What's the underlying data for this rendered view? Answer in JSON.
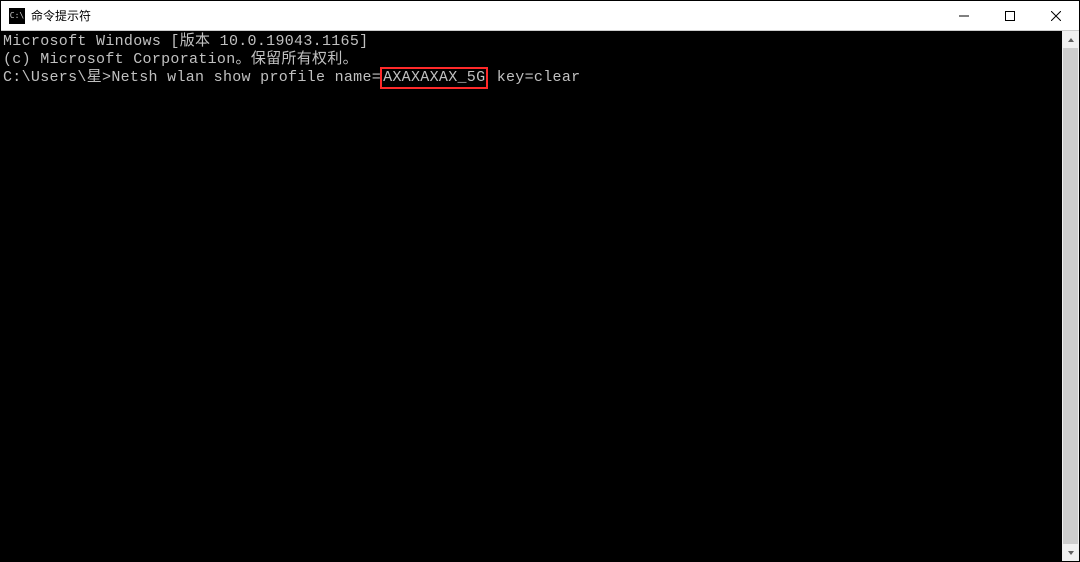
{
  "titlebar": {
    "icon_label": "C:\\",
    "title": "命令提示符"
  },
  "terminal": {
    "line1_a": "Microsoft Windows [版本 ",
    "line1_b": "10.0.19043.1165",
    "line1_c": "]",
    "line2": "(c) Microsoft Corporation。保留所有权利。",
    "blank": "",
    "prompt": "C:\\Users\\星>",
    "cmd_pre": "Netsh wlan show profile name=",
    "cmd_highlight": "AXAXAXAX_5G",
    "cmd_post": " key=clear"
  }
}
